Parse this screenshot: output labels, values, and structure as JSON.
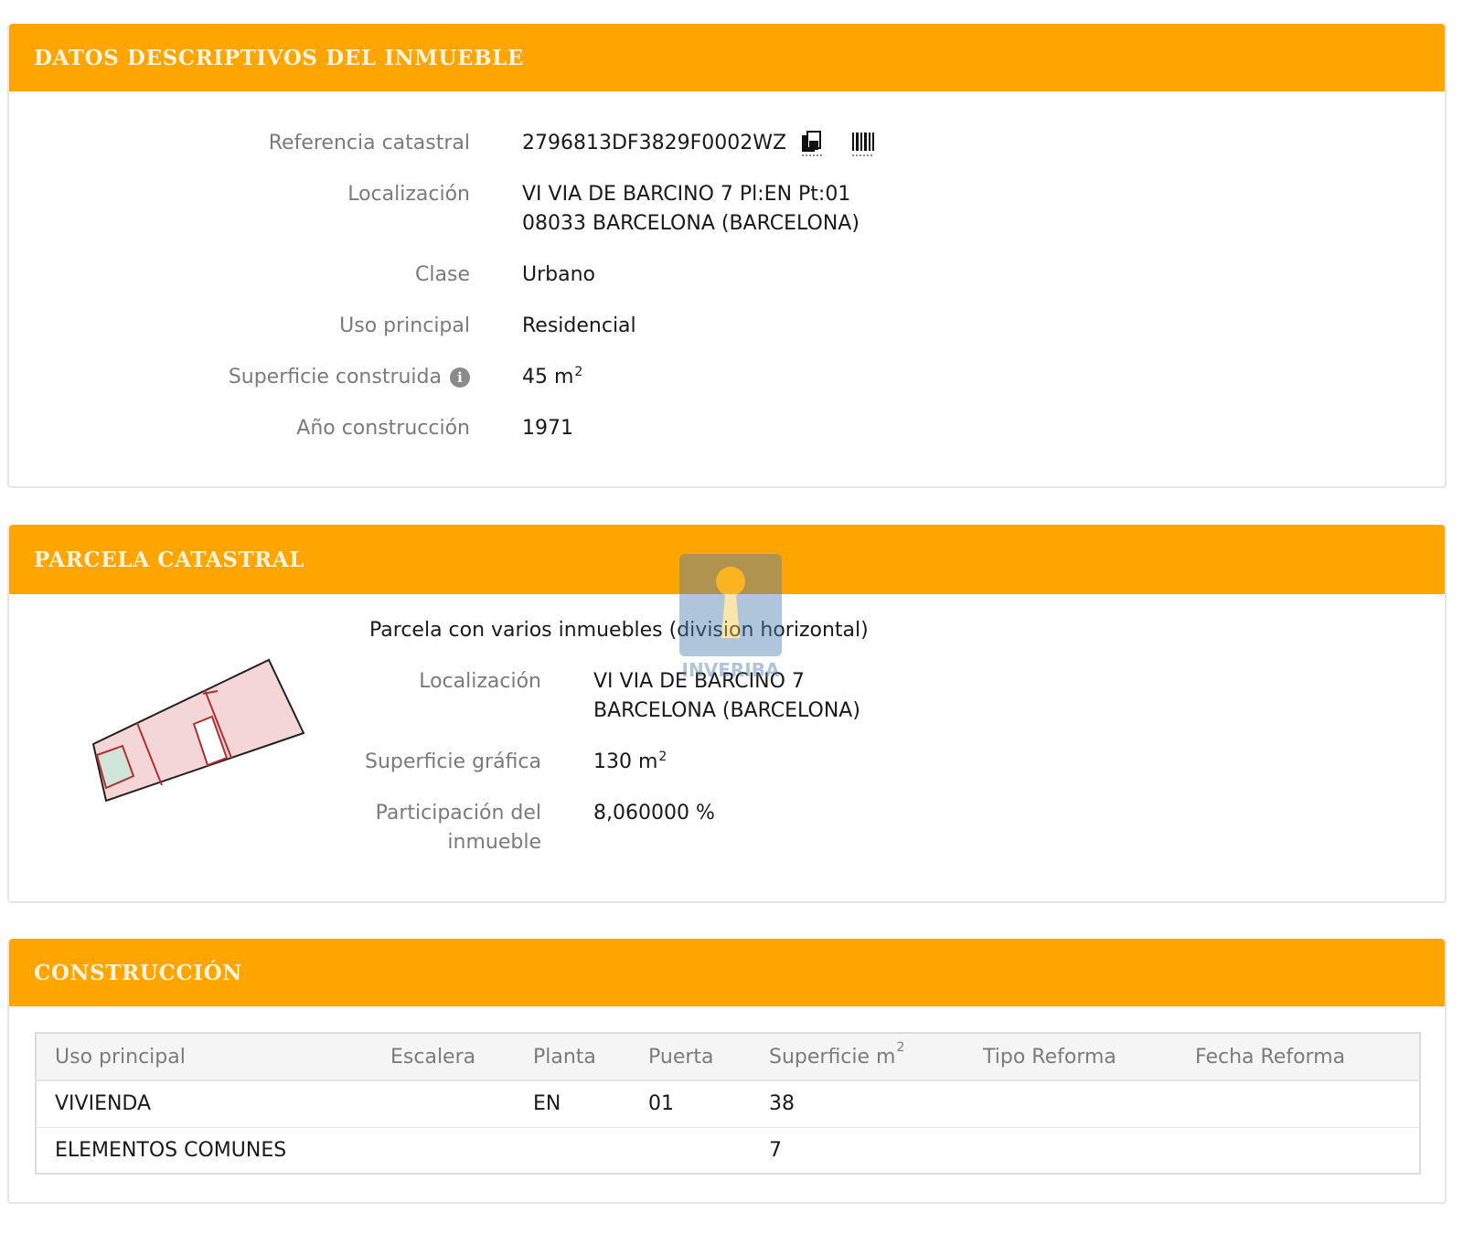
{
  "inmueble": {
    "title": "DATOS DESCRIPTIVOS DEL INMUEBLE",
    "ref_label": "Referencia catastral",
    "ref_value": "2796813DF3829F0002WZ",
    "loc_label": "Localización",
    "loc_line1": "VI VIA DE BARCINO 7 Pl:EN Pt:01",
    "loc_line2": "08033 BARCELONA (BARCELONA)",
    "clase_label": "Clase",
    "clase_value": "Urbano",
    "uso_label": "Uso principal",
    "uso_value": "Residencial",
    "sup_label": "Superficie construida",
    "sup_value": "45 m",
    "sup_exp": "2",
    "anio_label": "Año construcción",
    "anio_value": "1971"
  },
  "parcela": {
    "title": "PARCELA CATASTRAL",
    "heading": "Parcela con varios inmuebles (division horizontal)",
    "loc_label": "Localización",
    "loc_line1": "VI VIA DE BARCINO 7",
    "loc_line2": "BARCELONA (BARCELONA)",
    "sup_label": "Superficie gráfica",
    "sup_value": "130 m",
    "sup_exp": "2",
    "part_label_line1": "Participación del",
    "part_label_line2": "inmueble",
    "part_value": "8,060000 %"
  },
  "construccion": {
    "title": "CONSTRUCCIÓN",
    "headers": {
      "uso": "Uso principal",
      "escalera": "Escalera",
      "planta": "Planta",
      "puerta": "Puerta",
      "superficie": "Superficie m",
      "superficie_exp": "2",
      "tipo": "Tipo Reforma",
      "fecha": "Fecha Reforma"
    },
    "rows": [
      {
        "uso": "VIVIENDA",
        "escalera": "",
        "planta": "EN",
        "puerta": "01",
        "superficie": "38",
        "tipo": "",
        "fecha": ""
      },
      {
        "uso": "ELEMENTOS COMUNES",
        "escalera": "",
        "planta": "",
        "puerta": "",
        "superficie": "7",
        "tipo": "",
        "fecha": ""
      }
    ]
  },
  "watermark": {
    "text": "INVERIBA"
  },
  "colors": {
    "header": "#ffa500",
    "parcel_fill": "#f4d6d6",
    "parcel_common": "#cfe5d9"
  },
  "icons": {
    "copy": "copy-icon",
    "barcode": "barcode-icon",
    "info": "info-icon"
  }
}
